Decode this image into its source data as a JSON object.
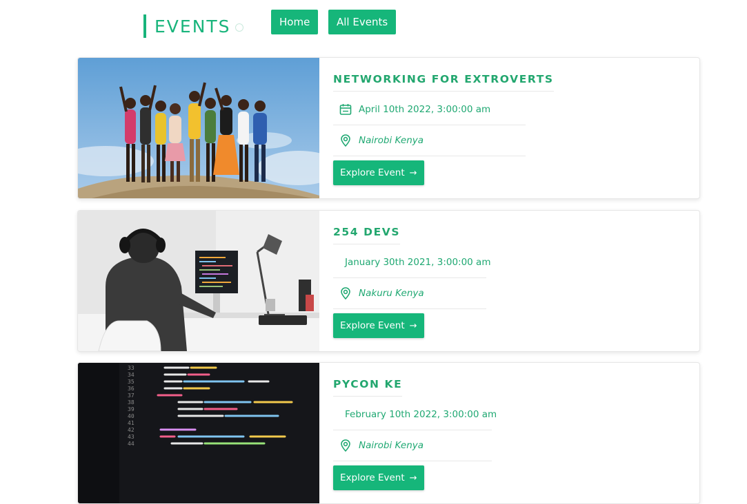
{
  "header": {
    "logo_text": "EVENTS",
    "nav": [
      {
        "label": "Home"
      },
      {
        "label": "All Events"
      }
    ]
  },
  "events": [
    {
      "title": "NETWORKING FOR EXTROVERTS",
      "date": "April 10th 2022, 3:00:00 am",
      "location": "Nairobi Kenya",
      "button_label": "Explore Event",
      "image": "group-of-people-on-hill-photo"
    },
    {
      "title": "254 DEVS",
      "date": "January 30th 2021, 3:00:00 am",
      "location": "Nakuru Kenya",
      "button_label": "Explore Event",
      "image": "developer-at-desk-photo"
    },
    {
      "title": "PYCON KE",
      "date": "February 10th 2022, 3:00:00 am",
      "location": "Nairobi Kenya",
      "button_label": "Explore Event",
      "image": "python-code-screen-photo"
    }
  ],
  "colors": {
    "accent": "#16b67a",
    "text_accent": "#23a76f"
  },
  "icons": {
    "date": "calendar-icon",
    "location": "map-pin-icon",
    "arrow": "arrow-right-icon"
  }
}
